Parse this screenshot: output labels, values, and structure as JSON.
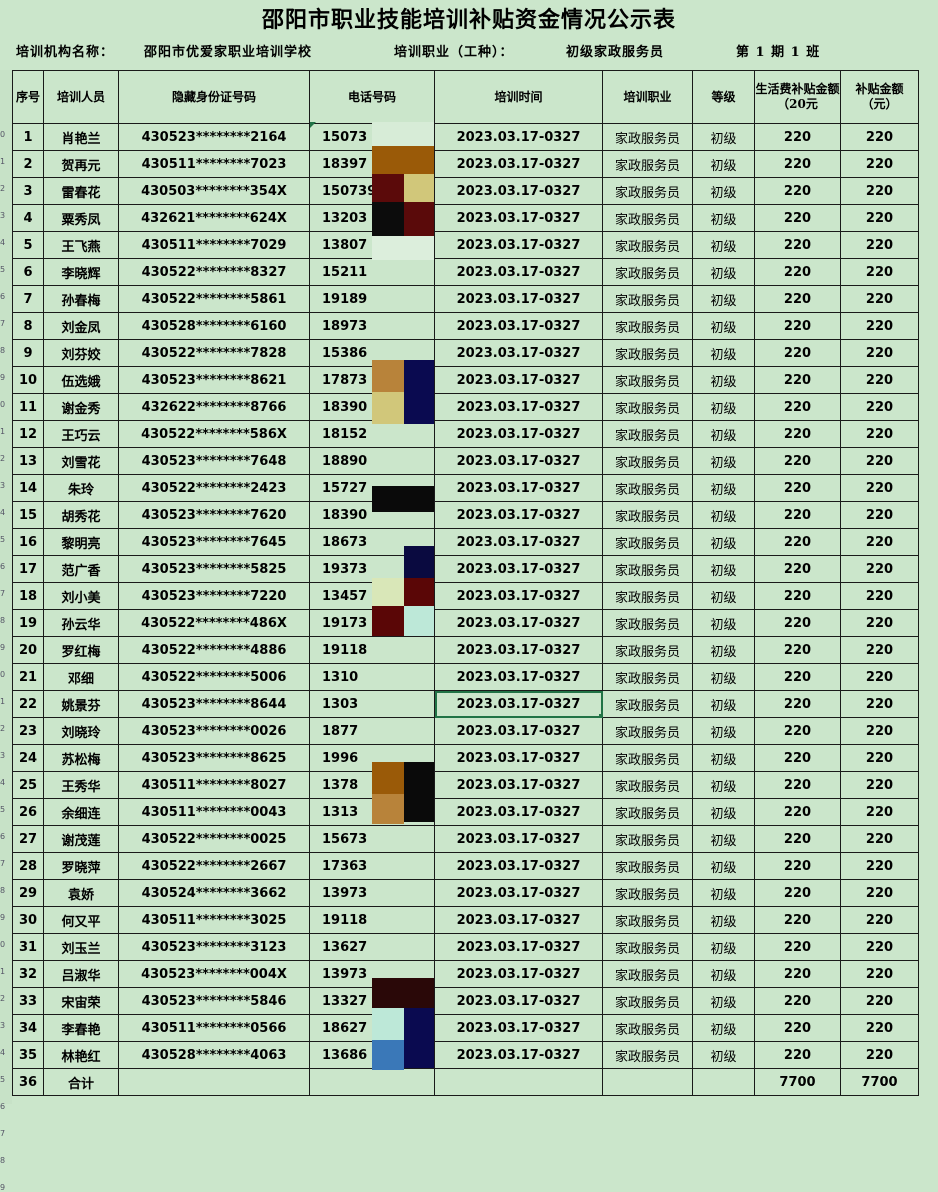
{
  "title": "邵阳市职业技能培训补贴资金情况公示表",
  "info": {
    "org_label": "培训机构名称：",
    "org_value": "邵阳市优爱家职业培训学校",
    "job_label": "培训职业（工种）：",
    "job_value": "初级家政服务员",
    "period_label": "第 1 期 1 班"
  },
  "headers": {
    "no": "序号",
    "name": "培训人员",
    "id": "隐藏身份证号码",
    "phone": "电话号码",
    "time": "培训时间",
    "job": "培训职业",
    "level": "等级",
    "living": "生活费补贴金额（20元",
    "subsidy": "补贴金额（元）"
  },
  "rows": [
    {
      "no": "1",
      "name": "肖艳兰",
      "id": "430523********2164",
      "phone": "15073",
      "time": "2023.03.17-0327",
      "job": "家政服务员",
      "level": "初级",
      "living": "220",
      "subsidy": "220"
    },
    {
      "no": "2",
      "name": "贺再元",
      "id": "430511********7023",
      "phone": "18397",
      "time": "2023.03.17-0327",
      "job": "家政服务员",
      "level": "初级",
      "living": "220",
      "subsidy": "220"
    },
    {
      "no": "3",
      "name": "雷春花",
      "id": "430503********354X",
      "phone": "150739",
      "time": "2023.03.17-0327",
      "job": "家政服务员",
      "level": "初级",
      "living": "220",
      "subsidy": "220"
    },
    {
      "no": "4",
      "name": "粟秀凤",
      "id": "432621********624X",
      "phone": "13203",
      "time": "2023.03.17-0327",
      "job": "家政服务员",
      "level": "初级",
      "living": "220",
      "subsidy": "220"
    },
    {
      "no": "5",
      "name": "王飞燕",
      "id": "430511********7029",
      "phone": "13807",
      "time": "2023.03.17-0327",
      "job": "家政服务员",
      "level": "初级",
      "living": "220",
      "subsidy": "220"
    },
    {
      "no": "6",
      "name": "李晓辉",
      "id": "430522********8327",
      "phone": "15211",
      "time": "2023.03.17-0327",
      "job": "家政服务员",
      "level": "初级",
      "living": "220",
      "subsidy": "220"
    },
    {
      "no": "7",
      "name": "孙春梅",
      "id": "430522********5861",
      "phone": "19189",
      "time": "2023.03.17-0327",
      "job": "家政服务员",
      "level": "初级",
      "living": "220",
      "subsidy": "220"
    },
    {
      "no": "8",
      "name": "刘金凤",
      "id": "430528********6160",
      "phone": "18973",
      "time": "2023.03.17-0327",
      "job": "家政服务员",
      "level": "初级",
      "living": "220",
      "subsidy": "220"
    },
    {
      "no": "9",
      "name": "刘芬姣",
      "id": "430522********7828",
      "phone": "15386",
      "time": "2023.03.17-0327",
      "job": "家政服务员",
      "level": "初级",
      "living": "220",
      "subsidy": "220"
    },
    {
      "no": "10",
      "name": "伍选娥",
      "id": "430523********8621",
      "phone": "17873",
      "time": "2023.03.17-0327",
      "job": "家政服务员",
      "level": "初级",
      "living": "220",
      "subsidy": "220"
    },
    {
      "no": "11",
      "name": "谢金秀",
      "id": "432622********8766",
      "phone": "18390",
      "time": "2023.03.17-0327",
      "job": "家政服务员",
      "level": "初级",
      "living": "220",
      "subsidy": "220"
    },
    {
      "no": "12",
      "name": "王巧云",
      "id": "430522********586X",
      "phone": "18152",
      "time": "2023.03.17-0327",
      "job": "家政服务员",
      "level": "初级",
      "living": "220",
      "subsidy": "220"
    },
    {
      "no": "13",
      "name": "刘雪花",
      "id": "430523********7648",
      "phone": "18890",
      "time": "2023.03.17-0327",
      "job": "家政服务员",
      "level": "初级",
      "living": "220",
      "subsidy": "220"
    },
    {
      "no": "14",
      "name": "朱玲",
      "id": "430522********2423",
      "phone": "15727",
      "time": "2023.03.17-0327",
      "job": "家政服务员",
      "level": "初级",
      "living": "220",
      "subsidy": "220"
    },
    {
      "no": "15",
      "name": "胡秀花",
      "id": "430523********7620",
      "phone": "18390",
      "time": "2023.03.17-0327",
      "job": "家政服务员",
      "level": "初级",
      "living": "220",
      "subsidy": "220"
    },
    {
      "no": "16",
      "name": "黎明亮",
      "id": "430523********7645",
      "phone": "18673",
      "time": "2023.03.17-0327",
      "job": "家政服务员",
      "level": "初级",
      "living": "220",
      "subsidy": "220"
    },
    {
      "no": "17",
      "name": "范广香",
      "id": "430523********5825",
      "phone": "19373",
      "time": "2023.03.17-0327",
      "job": "家政服务员",
      "level": "初级",
      "living": "220",
      "subsidy": "220"
    },
    {
      "no": "18",
      "name": "刘小美",
      "id": "430523********7220",
      "phone": "13457",
      "time": "2023.03.17-0327",
      "job": "家政服务员",
      "level": "初级",
      "living": "220",
      "subsidy": "220"
    },
    {
      "no": "19",
      "name": "孙云华",
      "id": "430522********486X",
      "phone": "19173",
      "time": "2023.03.17-0327",
      "job": "家政服务员",
      "level": "初级",
      "living": "220",
      "subsidy": "220"
    },
    {
      "no": "20",
      "name": "罗红梅",
      "id": "430522********4886",
      "phone": "19118",
      "time": "2023.03.17-0327",
      "job": "家政服务员",
      "level": "初级",
      "living": "220",
      "subsidy": "220"
    },
    {
      "no": "21",
      "name": "邓细",
      "id": "430522********5006",
      "phone": "1310",
      "time": "2023.03.17-0327",
      "job": "家政服务员",
      "level": "初级",
      "living": "220",
      "subsidy": "220"
    },
    {
      "no": "22",
      "name": "姚景芬",
      "id": "430523********8644",
      "phone": "1303",
      "time": "2023.03.17-0327",
      "job": "家政服务员",
      "level": "初级",
      "living": "220",
      "subsidy": "220"
    },
    {
      "no": "23",
      "name": "刘晓玲",
      "id": "430523********0026",
      "phone": "1877",
      "time": "2023.03.17-0327",
      "job": "家政服务员",
      "level": "初级",
      "living": "220",
      "subsidy": "220"
    },
    {
      "no": "24",
      "name": "苏松梅",
      "id": "430523********8625",
      "phone": "1996",
      "time": "2023.03.17-0327",
      "job": "家政服务员",
      "level": "初级",
      "living": "220",
      "subsidy": "220"
    },
    {
      "no": "25",
      "name": "王秀华",
      "id": "430511********8027",
      "phone": "1378",
      "time": "2023.03.17-0327",
      "job": "家政服务员",
      "level": "初级",
      "living": "220",
      "subsidy": "220"
    },
    {
      "no": "26",
      "name": "余细连",
      "id": "430511********0043",
      "phone": "1313",
      "time": "2023.03.17-0327",
      "job": "家政服务员",
      "level": "初级",
      "living": "220",
      "subsidy": "220"
    },
    {
      "no": "27",
      "name": "谢茂莲",
      "id": "430522********0025",
      "phone": "15673",
      "time": "2023.03.17-0327",
      "job": "家政服务员",
      "level": "初级",
      "living": "220",
      "subsidy": "220"
    },
    {
      "no": "28",
      "name": "罗晓萍",
      "id": "430522********2667",
      "phone": "17363",
      "time": "2023.03.17-0327",
      "job": "家政服务员",
      "level": "初级",
      "living": "220",
      "subsidy": "220"
    },
    {
      "no": "29",
      "name": "袁娇",
      "id": "430524********3662",
      "phone": "13973",
      "time": "2023.03.17-0327",
      "job": "家政服务员",
      "level": "初级",
      "living": "220",
      "subsidy": "220"
    },
    {
      "no": "30",
      "name": "何又平",
      "id": "430511********3025",
      "phone": "19118",
      "time": "2023.03.17-0327",
      "job": "家政服务员",
      "level": "初级",
      "living": "220",
      "subsidy": "220"
    },
    {
      "no": "31",
      "name": "刘玉兰",
      "id": "430523********3123",
      "phone": "13627",
      "time": "2023.03.17-0327",
      "job": "家政服务员",
      "level": "初级",
      "living": "220",
      "subsidy": "220"
    },
    {
      "no": "32",
      "name": "吕淑华",
      "id": "430523********004X",
      "phone": "13973",
      "time": "2023.03.17-0327",
      "job": "家政服务员",
      "level": "初级",
      "living": "220",
      "subsidy": "220"
    },
    {
      "no": "33",
      "name": "宋宙荣",
      "id": "430523********5846",
      "phone": "13327",
      "time": "2023.03.17-0327",
      "job": "家政服务员",
      "level": "初级",
      "living": "220",
      "subsidy": "220"
    },
    {
      "no": "34",
      "name": "李春艳",
      "id": "430511********0566",
      "phone": "18627",
      "time": "2023.03.17-0327",
      "job": "家政服务员",
      "level": "初级",
      "living": "220",
      "subsidy": "220"
    },
    {
      "no": "35",
      "name": "林艳红",
      "id": "430528********4063",
      "phone": "13686",
      "time": "2023.03.17-0327",
      "job": "家政服务员",
      "level": "初级",
      "living": "220",
      "subsidy": "220"
    }
  ],
  "total": {
    "no": "36",
    "label": "合计",
    "living": "7700",
    "subsidy": "7700"
  },
  "left_row_numbers": [
    "0",
    "1",
    "2",
    "3",
    "4",
    "5",
    "6",
    "7",
    "8",
    "9",
    "0",
    "1",
    "2",
    "3",
    "4",
    "5",
    "6",
    "7",
    "8",
    "9",
    "0",
    "1",
    "2",
    "3",
    "4",
    "5",
    "6",
    "7",
    "8",
    "9",
    "0",
    "1",
    "2",
    "3",
    "4",
    "5",
    "6",
    "7",
    "8",
    "9"
  ],
  "colors": {
    "sheet_bg": "#cbe6cb",
    "grid_line": "#1a1a1a",
    "selection": "#217346"
  }
}
